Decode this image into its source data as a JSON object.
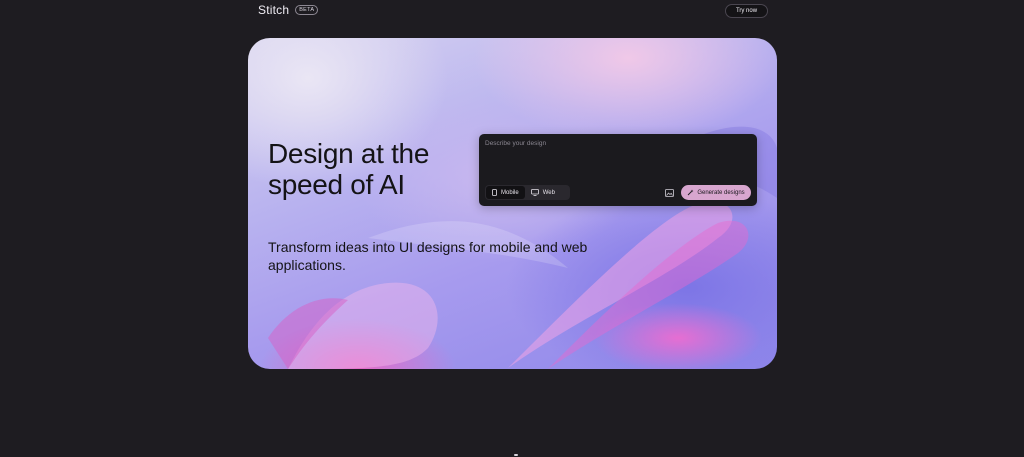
{
  "header": {
    "brand": "Stitch",
    "badge": "BETA",
    "cta_label": "Try now"
  },
  "hero": {
    "headline_line1": "Design at the",
    "headline_line2": "speed of AI",
    "subheadline": "Transform ideas into UI designs for mobile and web applications."
  },
  "prompt": {
    "placeholder": "Describe your design",
    "modes": [
      {
        "label": "Mobile",
        "icon": "phone-icon",
        "selected": true
      },
      {
        "label": "Web",
        "icon": "monitor-icon",
        "selected": false
      }
    ],
    "image_icon": "image-upload-icon",
    "generate_label": "Generate designs",
    "generate_icon": "sparkle-wand-icon"
  },
  "colors": {
    "page_background": "#1e1c21",
    "prompt_background": "#1b1a1e",
    "generate_button": "#d8a6cf",
    "headline_text": "#141316"
  }
}
